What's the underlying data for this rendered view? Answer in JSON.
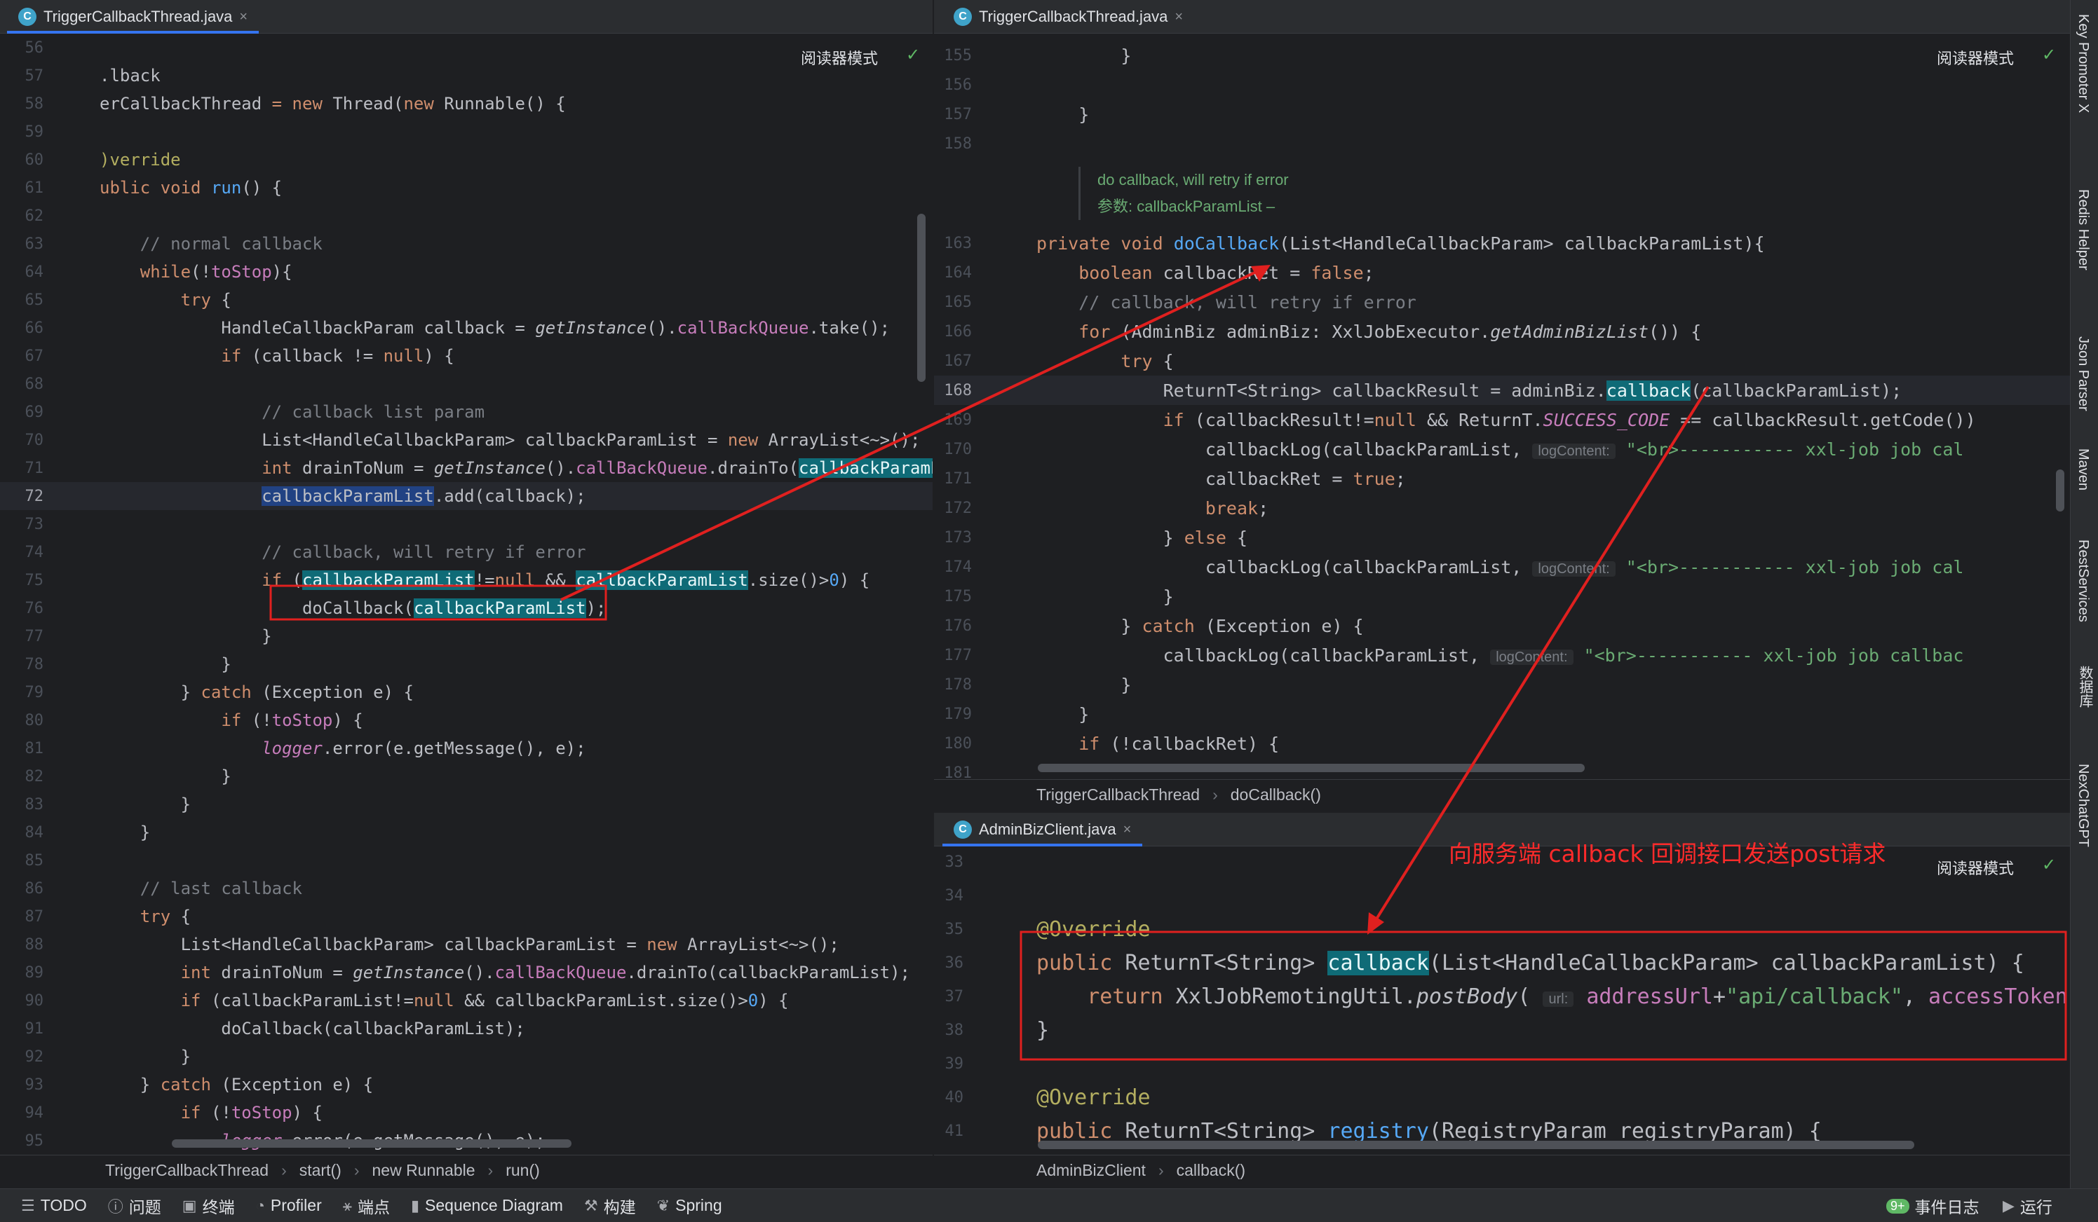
{
  "left_pane": {
    "tab": {
      "icon": "java-class-icon",
      "label": "TriggerCallbackThread.java"
    },
    "reader_mode": "阅读器模式",
    "lines": [
      {
        "n": "56",
        "html": ""
      },
      {
        "n": "57",
        "html": ".lback"
      },
      {
        "n": "58",
        "html": "erCallbackThread <span class='c-kw'>= new</span> Thread(<span class='c-kw'>new</span> Runnable() {"
      },
      {
        "n": "59",
        "html": ""
      },
      {
        "n": "60",
        "html": "<span class='c-ann'>)verride</span>"
      },
      {
        "n": "61",
        "html": "<span class='c-kw'>ublic void</span> <span class='c-fn'>run</span>() {"
      },
      {
        "n": "62",
        "html": ""
      },
      {
        "n": "63",
        "html": "    <span class='c-cm'>// normal callback</span>"
      },
      {
        "n": "64",
        "html": "    <span class='c-kw'>while</span>(!<span class='c-fld'>toStop</span>){"
      },
      {
        "n": "65",
        "html": "        <span class='c-kw'>try</span> {"
      },
      {
        "n": "66",
        "html": "            HandleCallbackParam callback = <span class='c-st'>getInstance</span>().<span class='c-fld'>callBackQueue</span>.take();"
      },
      {
        "n": "67",
        "html": "            <span class='c-kw'>if</span> (callback != <span class='c-kw'>null</span>) {"
      },
      {
        "n": "68",
        "html": ""
      },
      {
        "n": "69",
        "html": "                <span class='c-cm'>// callback list param</span>"
      },
      {
        "n": "70",
        "html": "                List&lt;HandleCallbackParam&gt; callbackParamList = <span class='c-kw'>new</span> ArrayList&lt;~&gt;();"
      },
      {
        "n": "71",
        "html": "                <span class='c-kw'>int</span> drainToNum = <span class='c-st'>getInstance</span>().<span class='c-fld'>callBackQueue</span>.drainTo(<span class='c-hl'>callbackParamList</span>"
      },
      {
        "n": "72",
        "html": "                <span class='c-sel'>callbackParamList</span>.add(callback);"
      },
      {
        "n": "73",
        "html": ""
      },
      {
        "n": "74",
        "html": "                <span class='c-cm'>// callback, will retry if error</span>"
      },
      {
        "n": "75",
        "html": "                <span class='c-kw'>if</span> (<span class='c-hl'>callbackParamList</span>!=<span class='c-kw'>null</span> &amp;&amp; <span class='c-hl'>callbackParamList</span>.size()&gt;<span class='c-fn'>0</span>) {"
      },
      {
        "n": "76",
        "html": "                    doCallback(<span class='c-hl'>callbackParamList</span>);"
      },
      {
        "n": "77",
        "html": "                }"
      },
      {
        "n": "78",
        "html": "            }"
      },
      {
        "n": "79",
        "html": "        } <span class='c-kw'>catch</span> (Exception e) {"
      },
      {
        "n": "80",
        "html": "            <span class='c-kw'>if</span> (!<span class='c-fld'>toStop</span>) {"
      },
      {
        "n": "81",
        "html": "                <span class='c-fld c-st'>logger</span>.error(e.getMessage(), e);"
      },
      {
        "n": "82",
        "html": "            }"
      },
      {
        "n": "83",
        "html": "        }"
      },
      {
        "n": "84",
        "html": "    }"
      },
      {
        "n": "85",
        "html": ""
      },
      {
        "n": "86",
        "html": "    <span class='c-cm'>// last callback</span>"
      },
      {
        "n": "87",
        "html": "    <span class='c-kw'>try</span> {"
      },
      {
        "n": "88",
        "html": "        List&lt;HandleCallbackParam&gt; callbackParamList = <span class='c-kw'>new</span> ArrayList&lt;~&gt;();"
      },
      {
        "n": "89",
        "html": "        <span class='c-kw'>int</span> drainToNum = <span class='c-st'>getInstance</span>().<span class='c-fld'>callBackQueue</span>.drainTo(callbackParamList);"
      },
      {
        "n": "90",
        "html": "        <span class='c-kw'>if</span> (callbackParamList!=<span class='c-kw'>null</span> &amp;&amp; callbackParamList.size()&gt;<span class='c-fn'>0</span>) {"
      },
      {
        "n": "91",
        "html": "            doCallback(callbackParamList);"
      },
      {
        "n": "92",
        "html": "        }"
      },
      {
        "n": "93",
        "html": "    } <span class='c-kw'>catch</span> (Exception e) {"
      },
      {
        "n": "94",
        "html": "        <span class='c-kw'>if</span> (!<span class='c-fld'>toStop</span>) {"
      },
      {
        "n": "95",
        "html": "            <span class='c-fld c-st'>logger</span>.error(e.getMessage(), e);"
      }
    ],
    "breadcrumb": [
      "TriggerCallbackThread",
      "start()",
      "new Runnable",
      "run()"
    ]
  },
  "right_top_pane": {
    "tab": {
      "icon": "java-class-icon",
      "label": "TriggerCallbackThread.java"
    },
    "reader_mode": "阅读器模式",
    "lines_a": [
      {
        "n": "155",
        "html": "        }"
      },
      {
        "n": "156",
        "html": ""
      },
      {
        "n": "157",
        "html": "    }"
      },
      {
        "n": "158",
        "html": ""
      }
    ],
    "doc": [
      "do callback, will retry if error",
      "参数: callbackParamList –"
    ],
    "lines_b": [
      {
        "n": "163",
        "html": "<span class='c-kw'>private void</span> <span class='c-fn'>doCallback</span>(List&lt;HandleCallbackParam&gt; callbackParamList){"
      },
      {
        "n": "164",
        "html": "    <span class='c-kw'>boolean</span> callbackRet = <span class='c-kw'>false</span>;"
      },
      {
        "n": "165",
        "html": "    <span class='c-cm'>// callback, will retry if error</span>"
      },
      {
        "n": "166",
        "html": "    <span class='c-kw'>for</span> (AdminBiz adminBiz: XxlJobExecutor.<span class='c-st'>getAdminBizList</span>()) {"
      },
      {
        "n": "167",
        "html": "        <span class='c-kw'>try</span> {"
      },
      {
        "n": "168",
        "html": "            ReturnT&lt;String&gt; callbackResult = adminBiz.<span class='c-hl'>callback</span>(callbackParamList);"
      },
      {
        "n": "169",
        "html": "            <span class='c-kw'>if</span> (callbackResult!=<span class='c-kw'>null</span> &amp;&amp; ReturnT.<span class='c-fld c-st'>SUCCESS_CODE</span> == callbackResult.getCode())"
      },
      {
        "n": "170",
        "html": "                callbackLog(callbackParamList, <span class='hint'>logContent:</span> <span class='c-str'>\"&lt;br&gt;----------- xxl-job job cal</span>"
      },
      {
        "n": "171",
        "html": "                callbackRet = <span class='c-kw'>true</span>;"
      },
      {
        "n": "172",
        "html": "                <span class='c-kw'>break</span>;"
      },
      {
        "n": "173",
        "html": "            } <span class='c-kw'>else</span> {"
      },
      {
        "n": "174",
        "html": "                callbackLog(callbackParamList, <span class='hint'>logContent:</span> <span class='c-str'>\"&lt;br&gt;----------- xxl-job job cal</span>"
      },
      {
        "n": "175",
        "html": "            }"
      },
      {
        "n": "176",
        "html": "        } <span class='c-kw'>catch</span> (Exception e) {"
      },
      {
        "n": "177",
        "html": "            callbackLog(callbackParamList, <span class='hint'>logContent:</span> <span class='c-str'>\"&lt;br&gt;----------- xxl-job job callbac</span>"
      },
      {
        "n": "178",
        "html": "        }"
      },
      {
        "n": "179",
        "html": "    }"
      },
      {
        "n": "180",
        "html": "    <span class='c-kw'>if</span> (!callbackRet) {"
      },
      {
        "n": "181",
        "html": ""
      }
    ],
    "breadcrumb": [
      "TriggerCallbackThread",
      "doCallback()"
    ]
  },
  "right_bottom_pane": {
    "tab": {
      "icon": "java-class-icon",
      "label": "AdminBizClient.java"
    },
    "reader_mode": "阅读器模式",
    "lines": [
      {
        "n": "33",
        "html": ""
      },
      {
        "n": "34",
        "html": ""
      },
      {
        "n": "35",
        "html": "<span class='c-ann'>@Override</span>"
      },
      {
        "n": "36",
        "html": "<span class='c-kw'>public</span> ReturnT&lt;String&gt; <span class='c-hl'>callback</span>(List&lt;HandleCallbackParam&gt; callbackParamList) {"
      },
      {
        "n": "37",
        "html": "    <span class='c-kw'>return</span> XxlJobRemotingUtil.<span class='c-st'>postBody</span>( <span class='hint'>url:</span> <span class='c-fld'>addressUrl</span>+<span class='c-str'>\"api/callback\"</span>, <span class='c-fld'>accessToken</span>,"
      },
      {
        "n": "38",
        "html": "}"
      },
      {
        "n": "39",
        "html": ""
      },
      {
        "n": "40",
        "html": "<span class='c-ann'>@Override</span>"
      },
      {
        "n": "41",
        "html": "<span class='c-kw'>public</span> ReturnT&lt;String&gt; <span class='c-fn'>registry</span>(RegistryParam registryParam) {"
      }
    ],
    "breadcrumb": [
      "AdminBizClient",
      "callback()"
    ]
  },
  "annotation": {
    "text": "向服务端 callback 回调接口发送post请求",
    "color": "#ff2b2b"
  },
  "status_bar": {
    "left": [
      {
        "icon": "list-icon",
        "label": "TODO"
      },
      {
        "icon": "info-icon",
        "label": "问题"
      },
      {
        "icon": "terminal-icon",
        "label": "终端"
      },
      {
        "icon": "profiler-icon",
        "label": "Profiler"
      },
      {
        "icon": "endpoints-icon",
        "label": "端点"
      },
      {
        "icon": "sequence-diagram-icon",
        "label": "Sequence Diagram"
      },
      {
        "icon": "build-icon",
        "label": "构建"
      },
      {
        "icon": "spring-icon",
        "label": "Spring"
      }
    ],
    "event_log": {
      "badge": "9+",
      "label": "事件日志"
    },
    "run": {
      "label": "运行"
    }
  },
  "right_toolbar": [
    "Key Promoter X",
    "Redis Helper",
    "Json Parser",
    "Maven",
    "RestServices",
    "数据库",
    "NexChatGPT"
  ]
}
